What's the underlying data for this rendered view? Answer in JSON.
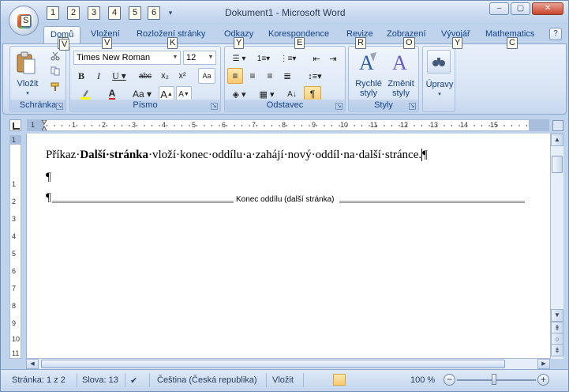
{
  "window": {
    "title": "Dokument1 - Microsoft Word",
    "controls": {
      "minimize": "–",
      "maximize": "▢",
      "close": "✕"
    }
  },
  "quick_access": {
    "keytips": [
      "1",
      "2",
      "3",
      "4",
      "5",
      "6"
    ]
  },
  "tabs": [
    {
      "label": "Domů",
      "keytip": "Ú",
      "active": true
    },
    {
      "label": "Vložení",
      "keytip": "V"
    },
    {
      "label": "Rozložení stránky",
      "keytip": "K"
    },
    {
      "label": "Odkazy",
      "keytip": "Y"
    },
    {
      "label": "Korespondence",
      "keytip": "E"
    },
    {
      "label": "Revize",
      "keytip": "R"
    },
    {
      "label": "Zobrazení",
      "keytip": "O"
    },
    {
      "label": "Vývojář",
      "keytip": "Y"
    },
    {
      "label": "Mathematics",
      "keytip": "C"
    }
  ],
  "help": "?",
  "ribbon": {
    "clipboard": {
      "label": "Schránka",
      "paste": "Vložit"
    },
    "font": {
      "label": "Písmo",
      "font_name": "Times New Roman",
      "font_size": "12"
    },
    "paragraph": {
      "label": "Odstavec"
    },
    "styles": {
      "label": "Styly",
      "quick_styles": "Rychlé styly",
      "change_styles": "Změnit styly"
    },
    "editing": {
      "label": "Úpravy"
    }
  },
  "ruler": {
    "numbers": [
      "1",
      "1",
      "2",
      "3",
      "4",
      "5",
      "6",
      "7",
      "8",
      "9",
      "10",
      "11",
      "12",
      "13",
      "14",
      "15"
    ]
  },
  "vruler": {
    "numbers": [
      "1",
      "1",
      "2",
      "3",
      "4",
      "5",
      "6",
      "7",
      "8",
      "9",
      "10",
      "11"
    ]
  },
  "document": {
    "line1_prefix": "Příkaz·",
    "line1_bold": "Další·stránka",
    "line1_suffix": "·vloží·konec·oddílu·a·zahájí·nový·oddíl·na·další·stránce.",
    "pilcrow": "¶",
    "section_break_label": "Konec oddílu (další stránka)"
  },
  "status": {
    "page": "Stránka: 1 z 2",
    "words": "Slova: 13",
    "language": "Čeština (Česká republika)",
    "mode": "Vložit",
    "zoom": "100 %"
  }
}
